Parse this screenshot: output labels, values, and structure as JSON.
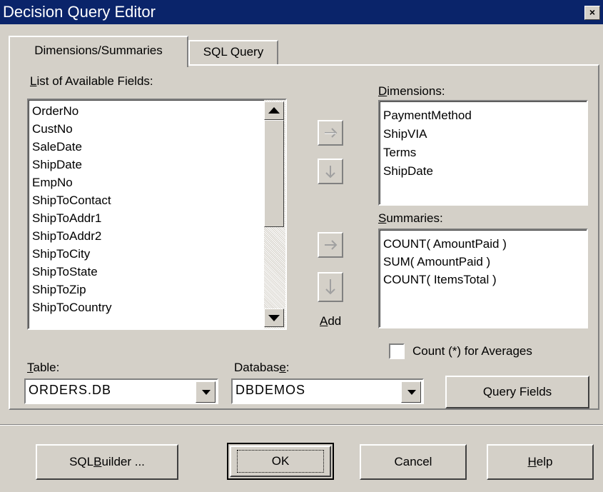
{
  "window": {
    "title": "Decision Query Editor",
    "close_glyph": "×"
  },
  "tabs": [
    {
      "label": "Dimensions/Summaries",
      "active": true
    },
    {
      "label": "SQL Query",
      "active": false
    }
  ],
  "available_fields": {
    "label_first": "L",
    "label_rest": "ist of Available Fields:",
    "items": [
      "OrderNo",
      "CustNo",
      "SaleDate",
      "ShipDate",
      "EmpNo",
      "ShipToContact",
      "ShipToAddr1",
      "ShipToAddr2",
      "ShipToCity",
      "ShipToState",
      "ShipToZip",
      "ShipToCountry"
    ]
  },
  "dimensions": {
    "label_first": "D",
    "label_rest": "imensions:",
    "items": [
      "PaymentMethod",
      "ShipVIA",
      "Terms",
      "ShipDate"
    ]
  },
  "summaries": {
    "label_first": "S",
    "label_rest": "ummaries:",
    "items": [
      "COUNT( AmountPaid )",
      "SUM( AmountPaid )",
      "COUNT( ItemsTotal )"
    ]
  },
  "add": {
    "label_first": "A",
    "label_rest": "dd"
  },
  "count_checkbox": {
    "label": "Count (*) for Averages",
    "checked": false
  },
  "table": {
    "label_first": "T",
    "label_rest": "able:",
    "value": "ORDERS.DB"
  },
  "database": {
    "label_pre": "Databas",
    "label_ul": "e",
    "label_post": ":",
    "value": "DBDEMOS"
  },
  "buttons": {
    "query_fields": "Query Fields",
    "sql_builder_pre": "SQL ",
    "sql_builder_ul": "B",
    "sql_builder_post": "uilder ...",
    "ok": "OK",
    "cancel": "Cancel",
    "help_ul": "H",
    "help_rest": "elp"
  },
  "icons": {
    "arrow_glyph": "→",
    "scroll_up": "scroll-up-icon",
    "scroll_down": "scroll-down-icon"
  }
}
